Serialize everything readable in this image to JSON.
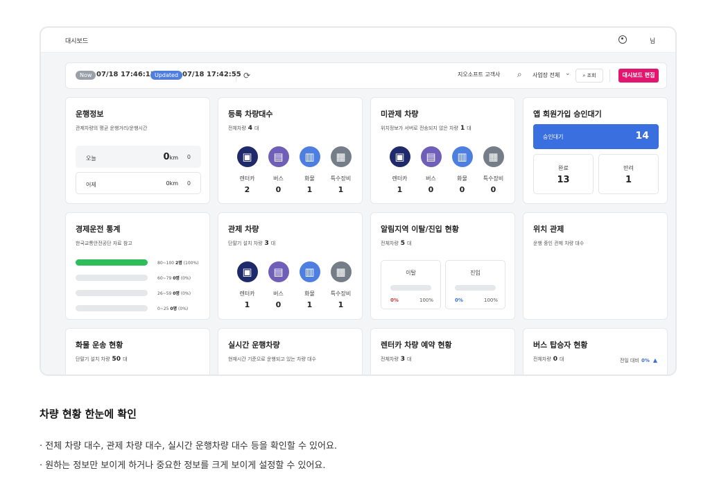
{
  "header": {
    "title": "대시보드",
    "user_name": "님"
  },
  "toolbar": {
    "now_badge": "Now",
    "now_time": "07/18 17:46:13",
    "updated_badge": "Updated",
    "updated_time": "07/18 17:42:55",
    "customer_value": "지오소프트 고객사",
    "site_select": "사업장 전체",
    "lookup_label": "조회",
    "edit_label": "대시보드 편집"
  },
  "colors": {
    "accent_pink": "#e2166e",
    "accent_blue": "#3a6fe0",
    "green": "#2ebd5a",
    "navy": "#1f2a6b",
    "purple": "#6f5fb8",
    "blue": "#4e7fe0",
    "gray": "#757d88",
    "red": "#d63a3a"
  },
  "vehicle_types": [
    {
      "name": "렌터카",
      "icon": "car-icon"
    },
    {
      "name": "버스",
      "icon": "bus-icon"
    },
    {
      "name": "화물",
      "icon": "truck-icon"
    },
    {
      "name": "특수장비",
      "icon": "special-vehicle-icon"
    }
  ],
  "cards": {
    "operation": {
      "title": "운행정보",
      "subtitle": "관제차량의 평균 운행거리/운행시간",
      "today": {
        "label": "오늘",
        "value": "0",
        "unit": "km",
        "time": "0"
      },
      "yesterday": {
        "label": "어제",
        "value": "0km",
        "time": "0"
      }
    },
    "registered": {
      "title": "등록 차량대수",
      "prefix": "전체차량",
      "count": "4",
      "unit": "대",
      "counts": [
        "2",
        "0",
        "1",
        "1"
      ]
    },
    "uncontrolled": {
      "title": "미관제 차량",
      "prefix": "위치정보가 서버로 전송되지 않은 차량",
      "count": "1",
      "unit": "대",
      "counts": [
        "1",
        "0",
        "0",
        "0"
      ]
    },
    "approval": {
      "title": "앱 회원가입 승인대기",
      "pending_label": "승인대기",
      "pending_value": "14",
      "done_label": "완료",
      "done_value": "13",
      "rejected_label": "반려",
      "rejected_value": "1"
    },
    "eco": {
      "title": "경제운전 통계",
      "subtitle": "한국교통안전공단 자료 참고",
      "rows": [
        {
          "range": "80~100",
          "count": "2명",
          "pct": "(100%)",
          "fill": 1.0
        },
        {
          "range": "60~79",
          "count": "0명",
          "pct": "(0%)",
          "fill": 0
        },
        {
          "range": "26~59",
          "count": "0명",
          "pct": "(0%)",
          "fill": 0
        },
        {
          "range": "0~25",
          "count": "0명",
          "pct": "(0%)",
          "fill": 0
        }
      ]
    },
    "controlled": {
      "title": "관제 차량",
      "prefix": "단말기 설치 차량",
      "count": "3",
      "unit": "대",
      "counts": [
        "1",
        "0",
        "1",
        "1"
      ]
    },
    "geofence": {
      "title": "알림지역 이탈/진입 현황",
      "prefix": "전체차량",
      "count": "5",
      "unit": "대",
      "exit": {
        "label": "이탈",
        "pct": "0%",
        "max": "100%",
        "fill": 0
      },
      "enter": {
        "label": "진입",
        "pct": "0%",
        "max": "100%",
        "fill": 0
      }
    },
    "location": {
      "title": "위치 관제",
      "subtitle": "운행 중인 관제 차량 대수"
    },
    "cargo": {
      "title": "화물 운송 현황",
      "prefix": "단말기 설치 차량",
      "count": "50",
      "unit": "대"
    },
    "realtime": {
      "title": "실시간 운행차량",
      "subtitle": "현재시간 기준으로 운행되고 있는 차량 대수"
    },
    "rental": {
      "title": "렌터카 차량 예약 현황",
      "prefix": "전체차량",
      "count": "3",
      "unit": "대"
    },
    "bus": {
      "title": "버스 탑승자 현황",
      "prefix": "전체차량",
      "count": "0",
      "unit": "대",
      "compare_label": "전일 대비",
      "compare_value": "0%"
    }
  },
  "description": {
    "title": "차량 현황 한눈에 확인",
    "lines": [
      "· 전체 차량 대수, 관제 차량 대수, 실시간 운행차량 대수 등을 확인할 수 있어요.",
      "· 원하는 정보만 보이게 하거나 중요한 정보를 크게 보이게 설정할 수 있어요."
    ]
  }
}
